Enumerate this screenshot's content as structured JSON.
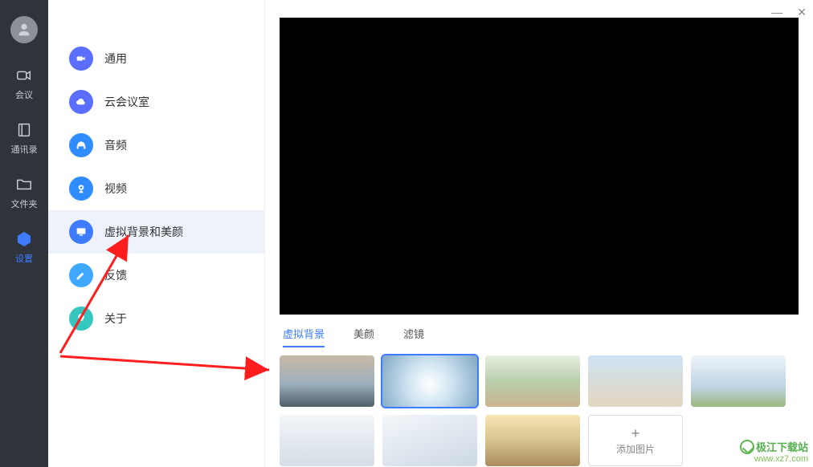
{
  "colors": {
    "accent": "#3e7bff",
    "rail_bg": "#2f333b"
  },
  "nav": {
    "items": [
      {
        "id": "meeting",
        "label": "会议",
        "icon": "camera-icon"
      },
      {
        "id": "contacts",
        "label": "通讯录",
        "icon": "book-icon"
      },
      {
        "id": "files",
        "label": "文件夹",
        "icon": "folder-icon"
      },
      {
        "id": "settings",
        "label": "设置",
        "icon": "gear-hex-icon",
        "active": true
      }
    ]
  },
  "settings": {
    "items": [
      {
        "id": "general",
        "label": "通用",
        "icon": "camera-dot-icon",
        "color": "#5a6eff"
      },
      {
        "id": "cloud",
        "label": "云会议室",
        "icon": "cloud-icon",
        "color": "#5a6eff"
      },
      {
        "id": "audio",
        "label": "音频",
        "icon": "headphone-icon",
        "color": "#2f8cff"
      },
      {
        "id": "video",
        "label": "视频",
        "icon": "webcam-icon",
        "color": "#2f8cff"
      },
      {
        "id": "vbg",
        "label": "虚拟背景和美颜",
        "icon": "monitor-icon",
        "color": "#3e7bff",
        "selected": true
      },
      {
        "id": "feedback",
        "label": "反馈",
        "icon": "pencil-icon",
        "color": "#3fa8ff"
      },
      {
        "id": "about",
        "label": "关于",
        "icon": "bulb-icon",
        "color": "#35c6c0"
      }
    ]
  },
  "content": {
    "tabs": [
      {
        "id": "virtual-bg",
        "label": "虚拟背景",
        "active": true
      },
      {
        "id": "beauty",
        "label": "美颜"
      },
      {
        "id": "filter",
        "label": "滤镜"
      }
    ],
    "thumbs": [
      {
        "id": "bg1",
        "name": "bridge-sky"
      },
      {
        "id": "bg2",
        "name": "light-tunnel",
        "selected": true
      },
      {
        "id": "bg3",
        "name": "classroom"
      },
      {
        "id": "bg4",
        "name": "office-window"
      },
      {
        "id": "bg5",
        "name": "city-plants"
      },
      {
        "id": "bg6",
        "name": "meeting-room"
      },
      {
        "id": "bg7",
        "name": "open-office"
      },
      {
        "id": "bg8",
        "name": "beach-sunset"
      }
    ],
    "add_label": "添加图片"
  },
  "watermark": {
    "line1": "极江下载站",
    "line2": "www.xz7.com"
  }
}
